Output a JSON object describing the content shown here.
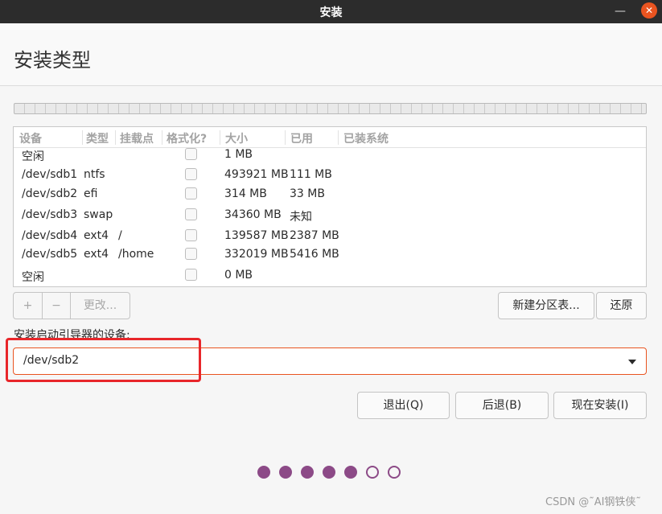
{
  "window": {
    "title": "安装",
    "minimize_icon": "minimize-icon",
    "close_icon": "close-icon"
  },
  "header": {
    "title": "安装类型"
  },
  "table": {
    "columns": [
      "设备",
      "类型",
      "挂载点",
      "格式化?",
      "大小",
      "已用",
      "已装系统"
    ],
    "rows": [
      {
        "device": "空闲",
        "type": "",
        "mount": "",
        "format": false,
        "size": "1 MB",
        "used": "",
        "system": ""
      },
      {
        "device": "/dev/sdb1",
        "type": "ntfs",
        "mount": "",
        "format": false,
        "size": "493921 MB",
        "used": "111 MB",
        "system": ""
      },
      {
        "device": "/dev/sdb2",
        "type": "efi",
        "mount": "",
        "format": false,
        "size": "314 MB",
        "used": "33 MB",
        "system": ""
      },
      {
        "device": "/dev/sdb3",
        "type": "swap",
        "mount": "",
        "format": false,
        "size": "34360 MB",
        "used": "未知",
        "system": ""
      },
      {
        "device": "/dev/sdb4",
        "type": "ext4",
        "mount": "/",
        "format": false,
        "size": "139587 MB",
        "used": "2387 MB",
        "system": ""
      },
      {
        "device": "/dev/sdb5",
        "type": "ext4",
        "mount": "/home",
        "format": false,
        "size": "332019 MB",
        "used": "5416 MB",
        "system": ""
      },
      {
        "device": "空闲",
        "type": "",
        "mount": "",
        "format": false,
        "size": "0 MB",
        "used": "",
        "system": ""
      }
    ]
  },
  "controls": {
    "add": "+",
    "remove": "−",
    "change": "更改...",
    "new_table": "新建分区表...",
    "revert": "还原"
  },
  "boot": {
    "label": "安装启动引导器的设备:",
    "value": "/dev/sdb2"
  },
  "actions": {
    "quit": "退出(Q)",
    "back": "后退(B)",
    "install": "现在安装(I)"
  },
  "progress": {
    "total_steps": 7,
    "current_step": 5
  },
  "watermark": "CSDN @˜AI钢铁侠˜",
  "colors": {
    "accent": "#e95420",
    "progress": "#8c4a87",
    "highlight": "#e8262a"
  }
}
